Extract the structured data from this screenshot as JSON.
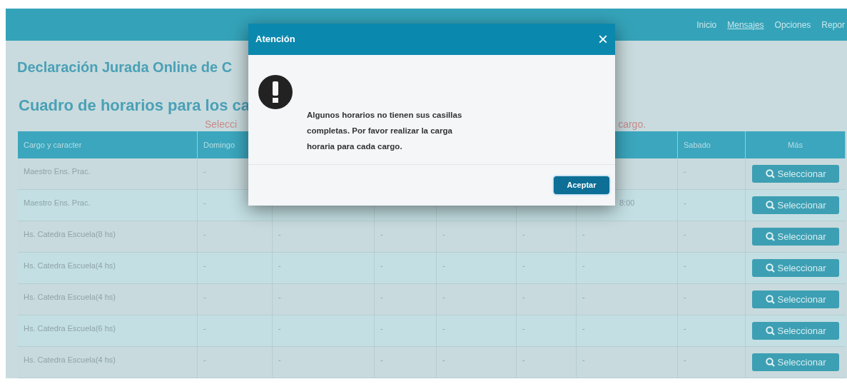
{
  "nav": [
    {
      "label": "Inicio",
      "underlined": false
    },
    {
      "label": "Mensajes",
      "underlined": true
    },
    {
      "label": "Opciones",
      "underlined": false
    },
    {
      "label": "Repor",
      "underlined": false
    }
  ],
  "title": "Declaración Jurada Online de C",
  "subtitle": "Cuadro de horarios para los ca",
  "hint_parts": [
    "Selecci",
    "cargo."
  ],
  "table": {
    "columns": {
      "cargo": "Cargo y caracter",
      "domingo": "Domingo",
      "sabado": "Sabado",
      "mas": "Más"
    },
    "rows": [
      {
        "cargo": "Maestro Ens. Prac.",
        "domingo": "-",
        "sabado": "-",
        "button": "Seleccionar"
      },
      {
        "cargo": "Maestro Ens. Prac.",
        "domingo": "-",
        "column_7": "8:00",
        "column_7_cut": true,
        "sabado": "-",
        "button": "Seleccionar"
      },
      {
        "cargo": "Hs. Catedra Escuela(8 hs)",
        "domingo": "-",
        "column_3": "-",
        "column_4": "-",
        "column_5": "-",
        "column_6": "-",
        "column_7": "-",
        "sabado": "-",
        "button": "Seleccionar"
      },
      {
        "cargo": "Hs. Catedra Escuela(4 hs)",
        "domingo": "-",
        "column_3": "-",
        "column_4": "-",
        "column_5": "-",
        "column_6": "-",
        "column_7": "-",
        "sabado": "-",
        "button": "Seleccionar"
      },
      {
        "cargo": "Hs. Catedra Escuela(4 hs)",
        "domingo": "-",
        "column_3": "-",
        "column_4": "-",
        "column_5": "-",
        "column_6": "-",
        "column_7": "-",
        "sabado": "-",
        "button": "Seleccionar"
      },
      {
        "cargo": "Hs. Catedra Escuela(6 hs)",
        "domingo": "-",
        "column_3": "-",
        "column_4": "-",
        "column_5": "-",
        "column_6": "-",
        "column_7": "-",
        "sabado": "-",
        "button": "Seleccionar"
      },
      {
        "cargo": "Hs. Catedra Escuela(4 hs)",
        "domingo": "-",
        "column_3": "-",
        "column_4": "-",
        "column_5": "-",
        "column_6": "-",
        "column_7": "-",
        "sabado": "-",
        "button": "Seleccionar"
      }
    ]
  },
  "dialog": {
    "title": "Atención",
    "close": "×",
    "message": "Algunos horarios no tienen sus casillas completas. Por favor realizar la carga horaria para cada cargo.",
    "button": "Aceptar"
  }
}
